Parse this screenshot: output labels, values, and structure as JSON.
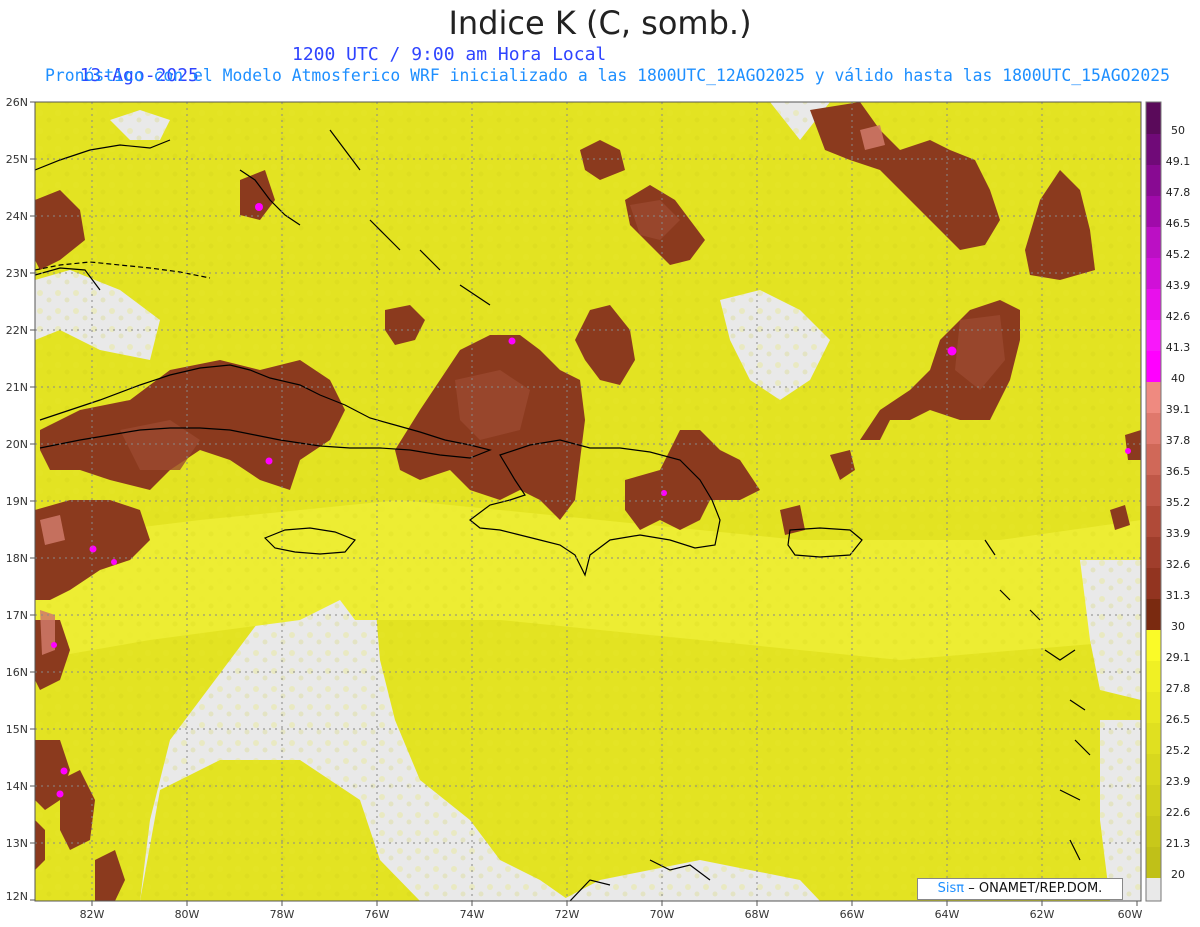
{
  "title": "Indice K (C, somb.)",
  "date": "13-Ago-2025",
  "time": "1200 UTC / 9:00 am Hora Local",
  "subtitle": "Pronóstico con el Modelo Atmosferico WRF inicializado a las 1800UTC_12AGO2025 y válido hasta las  1800UTC_15AGO2025",
  "credit": {
    "logo": "Sisπ",
    "text": "– ONAMET/REP.DOM."
  },
  "map": {
    "lon_range": [
      -83.2,
      -60.0
    ],
    "lat_range": [
      12,
      26
    ],
    "lat_labels": [
      "26N",
      "25N",
      "24N",
      "23N",
      "22N",
      "21N",
      "20N",
      "19N",
      "18N",
      "17N",
      "16N",
      "15N",
      "14N",
      "13N",
      "12N"
    ],
    "lon_labels": [
      "82W",
      "80W",
      "78W",
      "76W",
      "74W",
      "72W",
      "70W",
      "68W",
      "66W",
      "64W",
      "62W",
      "60W"
    ]
  },
  "colorbar": {
    "labels": [
      "50",
      "49.1",
      "47.8",
      "46.5",
      "45.2",
      "43.9",
      "42.6",
      "41.3",
      "40",
      "39.1",
      "37.8",
      "36.5",
      "35.2",
      "33.9",
      "32.6",
      "31.3",
      "30",
      "29.1",
      "27.8",
      "26.5",
      "25.2",
      "23.9",
      "22.6",
      "21.3",
      "20"
    ],
    "colors": {
      "lt20": "#e8e8e8",
      "20_30": "#d8d820",
      "30_40": "#8b3a1e",
      "40_50": "#ff00ff",
      "top": "#6a0a6a"
    }
  }
}
